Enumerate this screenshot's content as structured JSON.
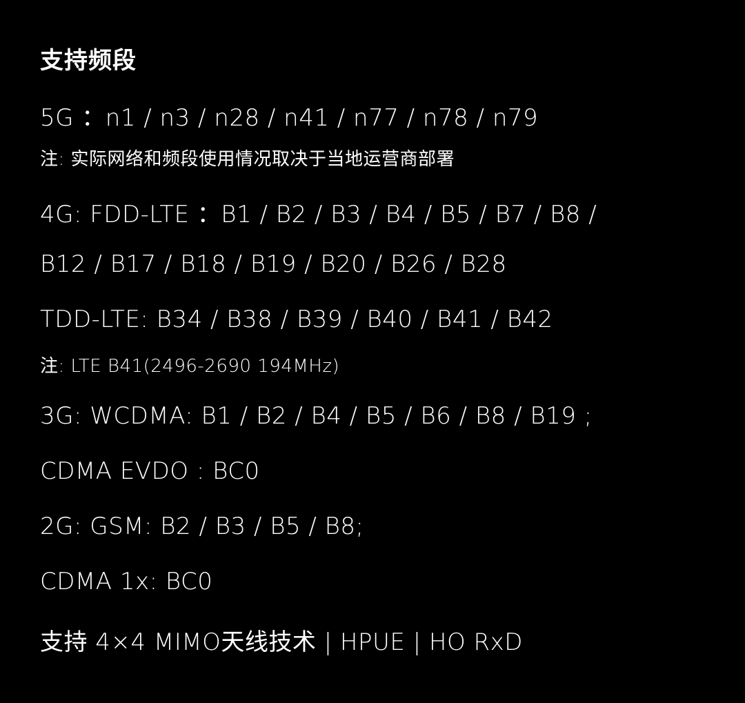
{
  "page": {
    "title": "支持频段",
    "lines": [
      {
        "kind": "spec",
        "text": "5G ：n1 / n3 / n28 / n41 / n77 / n78 / n79"
      },
      {
        "kind": "note",
        "text": "注: 实际网络和频段使用情况取决于当地运营商部署"
      },
      {
        "kind": "spec",
        "text": "4G: FDD-LTE ：B1 / B2 / B3 / B4 / B5 / B7 / B8 /"
      },
      {
        "kind": "spec",
        "text": "B12 / B17 / B18 / B19 / B20 / B26 / B28"
      },
      {
        "kind": "spec",
        "text": "TDD-LTE: B34 / B38 / B39 / B40 / B41 / B42"
      },
      {
        "kind": "note",
        "text": "注: LTE B41(2496-2690 194MHz)"
      },
      {
        "kind": "spec",
        "text": "3G: WCDMA: B1 / B2 / B4 / B5 / B6 / B8 / B19 ;"
      },
      {
        "kind": "spec",
        "text": "CDMA EVDO : BC0"
      },
      {
        "kind": "spec",
        "text": "2G: GSM: B2 / B3 / B5 / B8;"
      },
      {
        "kind": "spec",
        "text": "CDMA 1x: BC0"
      },
      {
        "kind": "spec",
        "text": "支持 4×4 MIMO天线技术 | HPUE | HO RxD"
      }
    ]
  }
}
